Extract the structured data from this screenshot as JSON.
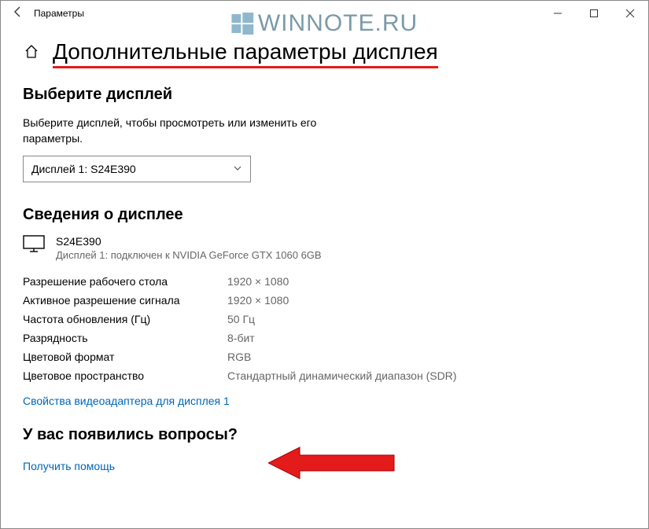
{
  "window": {
    "title": "Параметры"
  },
  "watermark": {
    "text": "WINNOTE.RU"
  },
  "page": {
    "title": "Дополнительные параметры дисплея"
  },
  "select_display": {
    "heading": "Выберите дисплей",
    "description": "Выберите дисплей, чтобы просмотреть или изменить его параметры.",
    "dropdown_value": "Дисплей 1: S24E390"
  },
  "display_info": {
    "heading": "Сведения о дисплее",
    "monitor_name": "S24E390",
    "monitor_sub": "Дисплей 1: подключен к NVIDIA GeForce GTX 1060 6GB",
    "rows": [
      {
        "k": "Разрешение рабочего стола",
        "v": "1920 × 1080"
      },
      {
        "k": "Активное разрешение сигнала",
        "v": "1920 × 1080"
      },
      {
        "k": "Частота обновления (Гц)",
        "v": "50 Гц"
      },
      {
        "k": "Разрядность",
        "v": "8-бит"
      },
      {
        "k": "Цветовой формат",
        "v": "RGB"
      },
      {
        "k": "Цветовое пространство",
        "v": "Стандартный динамический диапазон (SDR)"
      }
    ],
    "adapter_link": "Свойства видеоадаптера для дисплея 1"
  },
  "questions": {
    "heading": "У вас появились вопросы?",
    "help_link": "Получить помощь"
  }
}
